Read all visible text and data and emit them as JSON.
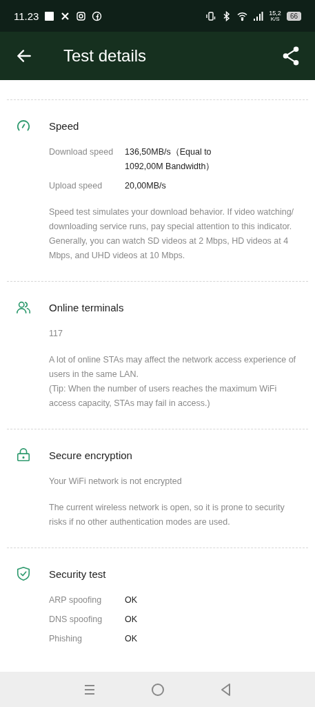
{
  "status_bar": {
    "time": "11.23",
    "speed_value": "15,2",
    "speed_unit": "K/S",
    "battery": "66"
  },
  "app_bar": {
    "title": "Test details"
  },
  "sections": [
    {
      "title": "Speed",
      "rows": [
        {
          "label": "Download speed",
          "value": "136,50MB/s（Equal to 1092,00M Bandwidth）"
        },
        {
          "label": "Upload speed",
          "value": "20,00MB/s"
        }
      ],
      "paragraphs": [
        [
          "Speed test simulates your download behavior. If video watching/ downloading service runs, pay special attention to this indicator. Generally, you can watch SD videos at 2 Mbps, HD videos at 4 Mbps, and UHD videos at 10 Mbps."
        ]
      ]
    },
    {
      "title": "Online terminals",
      "paragraphs": [
        [
          "117"
        ],
        [
          "A lot of online STAs may affect the network access experience of users in the same LAN.",
          "(Tip: When the number of users reaches the maximum WiFi access capacity, STAs may fail in access.)"
        ]
      ]
    },
    {
      "title": "Secure encryption",
      "paragraphs": [
        [
          "Your WiFi network is not encrypted"
        ],
        [
          "The current wireless network is open, so it is prone to security risks if no other authentication modes are used."
        ]
      ]
    },
    {
      "title": "Security test",
      "rows": [
        {
          "label": "ARP spoofing",
          "value": "OK"
        },
        {
          "label": "DNS spoofing",
          "value": "OK"
        },
        {
          "label": "Phishing",
          "value": "OK"
        }
      ]
    }
  ]
}
